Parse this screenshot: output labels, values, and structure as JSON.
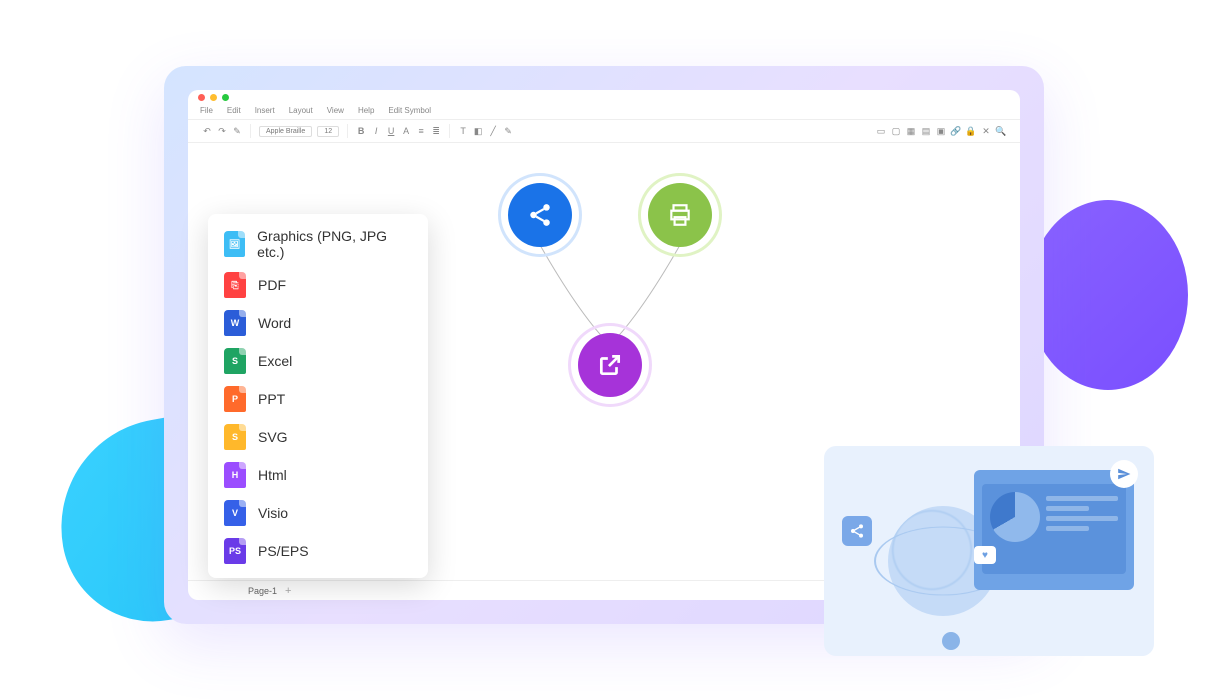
{
  "menus": {
    "file": "File",
    "edit": "Edit",
    "insert": "Insert",
    "layout": "Layout",
    "view": "View",
    "help": "Help",
    "edit_symbol": "Edit Symbol"
  },
  "toolbar": {
    "font_name": "Apple Braille",
    "font_size": "12"
  },
  "page_tab": "Page-1",
  "export_menu": {
    "graphics": "Graphics (PNG, JPG etc.)",
    "pdf": "PDF",
    "word": "Word",
    "excel": "Excel",
    "ppt": "PPT",
    "svg": "SVG",
    "html": "Html",
    "visio": "Visio",
    "ps": "PS/EPS"
  },
  "icon_letters": {
    "word": "W",
    "excel": "S",
    "ppt": "P",
    "svg": "S",
    "html": "H",
    "visio": "V",
    "ps": "PS"
  }
}
